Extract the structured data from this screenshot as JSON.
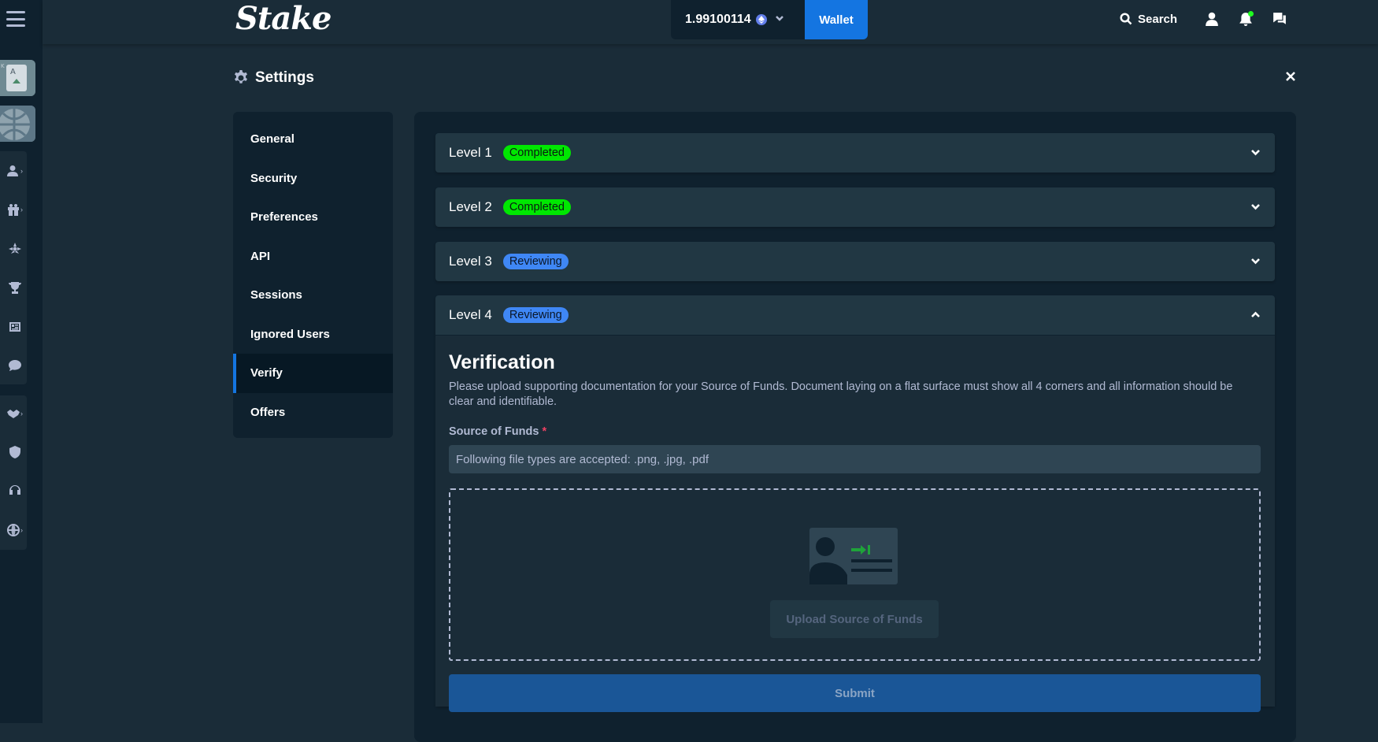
{
  "topbar": {
    "logo": "Stake",
    "balance": "1.99100114",
    "currency_icon": "ethereum-icon",
    "wallet_label": "Wallet",
    "search_label": "Search"
  },
  "rail": {
    "icons": [
      "casino-thumb",
      "sports-thumb",
      "user-icon",
      "gift-icon",
      "affiliate-icon",
      "trophy-icon",
      "blog-icon",
      "chat-icon",
      "sponsorship-icon",
      "shield-icon",
      "headset-icon",
      "globe-icon"
    ]
  },
  "settings": {
    "title": "Settings",
    "nav": [
      {
        "label": "General"
      },
      {
        "label": "Security"
      },
      {
        "label": "Preferences"
      },
      {
        "label": "API"
      },
      {
        "label": "Sessions"
      },
      {
        "label": "Ignored Users"
      },
      {
        "label": "Verify",
        "active": true
      },
      {
        "label": "Offers"
      }
    ]
  },
  "levels": [
    {
      "name": "Level 1",
      "status": "Completed"
    },
    {
      "name": "Level 2",
      "status": "Completed"
    },
    {
      "name": "Level 3",
      "status": "Reviewing"
    },
    {
      "name": "Level 4",
      "status": "Reviewing",
      "expanded": true
    }
  ],
  "verification": {
    "title": "Verification",
    "description": "Please upload supporting documentation for your Source of Funds. Document laying on a flat surface must show all 4 corners and all information should be clear and identifiable.",
    "field_label": "Source of Funds",
    "required_mark": "*",
    "accepted_types": "Following file types are accepted: .png, .jpg, .pdf",
    "upload_label": "Upload Source of Funds",
    "submit_label": "Submit"
  },
  "colors": {
    "background": "#1a2c38",
    "panel": "#0f212e",
    "accent": "#1475e1",
    "completed": "#00e701",
    "reviewing": "#3f87f5"
  }
}
